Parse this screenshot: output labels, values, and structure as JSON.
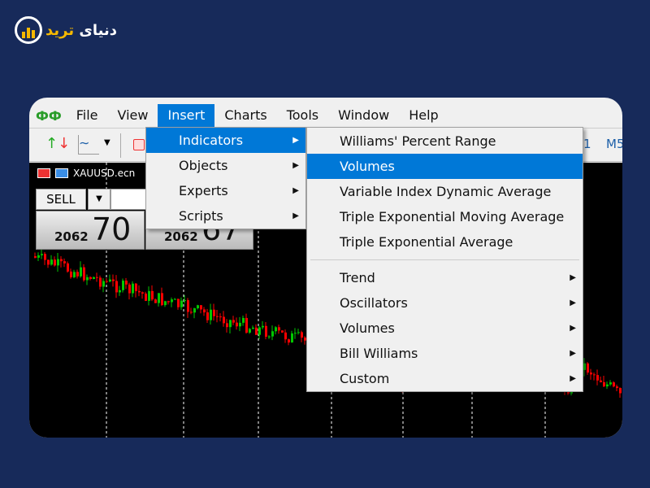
{
  "logo": {
    "text_a": "دنیای",
    "text_b": "ترید"
  },
  "menubar": [
    "File",
    "View",
    "Insert",
    "Charts",
    "Tools",
    "Window",
    "Help"
  ],
  "toolbar": {
    "timeframes": [
      "1",
      "M5"
    ]
  },
  "chart": {
    "symbol": "XAUUSD.ecn",
    "sell_label": "SELL",
    "bid_small": "2062",
    "bid_big": "70",
    "ask_small": "2062",
    "ask_big": "67"
  },
  "insert_menu": [
    {
      "label": "Indicators",
      "submenu": true
    },
    {
      "label": "Objects",
      "submenu": true
    },
    {
      "label": "Experts",
      "submenu": true
    },
    {
      "label": "Scripts",
      "submenu": true
    }
  ],
  "indicators_menu": {
    "recent": [
      "Williams' Percent Range",
      "Volumes",
      "Variable Index Dynamic Average",
      "Triple Exponential Moving Average",
      "Triple Exponential Average"
    ],
    "groups": [
      "Trend",
      "Oscillators",
      "Volumes",
      "Bill Williams",
      "Custom"
    ]
  },
  "colors": {
    "accent": "#0078d7",
    "bull": "#00c800",
    "bear": "#ff0000",
    "background": "#172a5a"
  }
}
